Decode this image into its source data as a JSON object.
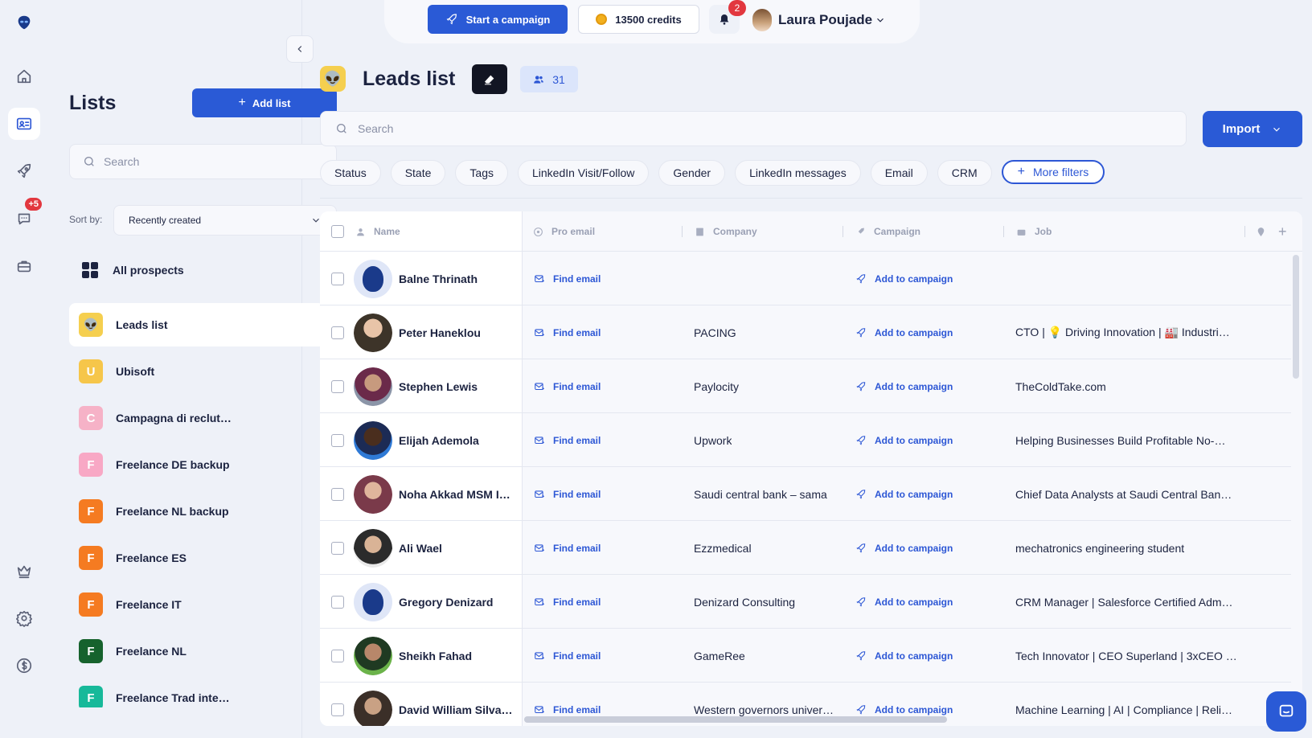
{
  "topbar": {
    "start_campaign": "Start a campaign",
    "credits": "13500 credits",
    "notifications_count": "2",
    "user_name": "Laura Poujade"
  },
  "rail": {
    "messages_badge": "+5"
  },
  "lists_panel": {
    "title": "Lists",
    "add_list": "Add list",
    "search_placeholder": "Search",
    "sort_label": "Sort by:",
    "sort_value": "Recently created",
    "all_prospects": "All prospects",
    "items": [
      {
        "label": "Leads list",
        "initial": "👽",
        "color": "#f5cf4f",
        "active": true
      },
      {
        "label": "Ubisoft",
        "initial": "U",
        "color": "#f6c64a"
      },
      {
        "label": "Campagna di reclut…",
        "initial": "C",
        "color": "#f6b2c7"
      },
      {
        "label": "Freelance DE backup",
        "initial": "F",
        "color": "#f8a8c5"
      },
      {
        "label": "Freelance NL backup",
        "initial": "F",
        "color": "#f57b21"
      },
      {
        "label": "Freelance ES",
        "initial": "F",
        "color": "#f57b21"
      },
      {
        "label": "Freelance IT",
        "initial": "F",
        "color": "#f57b21"
      },
      {
        "label": "Freelance NL",
        "initial": "F",
        "color": "#16622d"
      },
      {
        "label": "Freelance Trad inte…",
        "initial": "F",
        "color": "#17b99a"
      }
    ]
  },
  "main": {
    "title": "Leads list",
    "count": "31",
    "search_placeholder": "Search",
    "import_label": "Import",
    "filters": [
      "Status",
      "State",
      "Tags",
      "LinkedIn Visit/Follow",
      "Gender",
      "LinkedIn messages",
      "Email",
      "CRM"
    ],
    "more_filters": "More filters"
  },
  "table": {
    "columns": {
      "name": "Name",
      "pro_email": "Pro email",
      "company": "Company",
      "campaign": "Campaign",
      "job": "Job"
    },
    "find_email_label": "Find email",
    "add_campaign_label": "Add to campaign",
    "rows": [
      {
        "name": "Balne Thrinath",
        "company": "",
        "job": "",
        "avatar": "alien"
      },
      {
        "name": "Peter Haneklou",
        "company": "PACING",
        "job": "CTO | 💡 Driving Innovation | 🏭 Industri…",
        "avatar": "p1"
      },
      {
        "name": "Stephen Lewis",
        "company": "Paylocity",
        "job": "TheColdTake.com",
        "avatar": "p2"
      },
      {
        "name": "Elijah Ademola",
        "company": "Upwork",
        "job": "Helping Businesses Build Profitable No-…",
        "avatar": "p3"
      },
      {
        "name": "Noha Akkad MSM I…",
        "company": "Saudi central bank – sama",
        "job": "Chief Data Analysts at Saudi Central Ban…",
        "avatar": "p4"
      },
      {
        "name": "Ali Wael",
        "company": "Ezzmedical",
        "job": "mechatronics engineering student",
        "avatar": "p5"
      },
      {
        "name": "Gregory Denizard",
        "company": "Denizard Consulting",
        "job": "CRM Manager | Salesforce Certified Adm…",
        "avatar": "alien"
      },
      {
        "name": "Sheikh Fahad",
        "company": "GameRee",
        "job": "Tech Innovator | CEO Superland | 3xCEO …",
        "avatar": "p6"
      },
      {
        "name": "David William Silva …",
        "company": "Western governors univer…",
        "job": "Machine Learning | AI | Compliance | Reli…",
        "avatar": "p7"
      }
    ]
  }
}
